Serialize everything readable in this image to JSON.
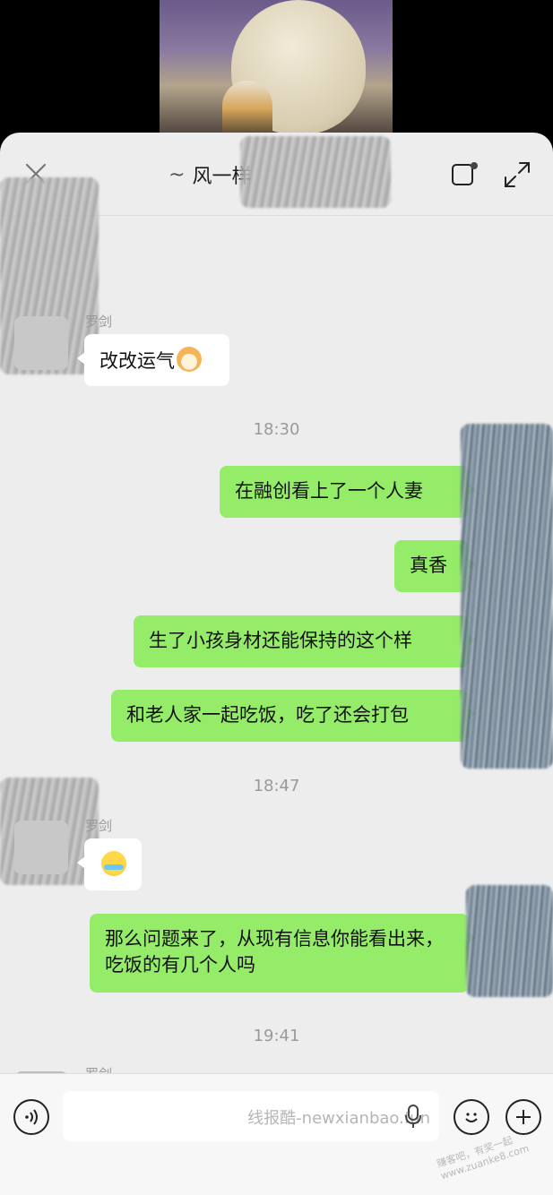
{
  "header": {
    "title_prefix": "~",
    "title": "风一样",
    "close_label": "close",
    "float_label": "float",
    "expand_label": "expand"
  },
  "messages": [
    {
      "type": "received",
      "sender": "罗剑",
      "text": "改改运气",
      "emoji": "doge"
    },
    {
      "type": "time",
      "text": "18:30"
    },
    {
      "type": "sent",
      "text": "在融创看上了一个人妻"
    },
    {
      "type": "sent",
      "text": "真香"
    },
    {
      "type": "sent",
      "text": "生了小孩身材还能保持的这个样"
    },
    {
      "type": "sent",
      "text": "和老人家一起吃饭，吃了还会打包"
    },
    {
      "type": "time",
      "text": "18:47"
    },
    {
      "type": "received",
      "sender": "罗剑",
      "text": "",
      "emoji": "cry"
    },
    {
      "type": "sent",
      "text": "那么问题来了，从现有信息你能看出来，吃饭的有几个人吗"
    },
    {
      "type": "time",
      "text": "19:41"
    },
    {
      "type": "received",
      "sender": "罗剑",
      "text": ""
    }
  ],
  "input": {
    "placeholder": "",
    "watermark": "线报酷-newxianbao.fun",
    "stamp_line1": "赚客吧，有奖一起",
    "stamp_line2": "www.zuanke8.com"
  },
  "colors": {
    "sent_bubble": "#95ec69",
    "received_bubble": "#ffffff",
    "chat_bg": "#ededed"
  },
  "icons": {
    "close": "close-icon",
    "float": "float-window-icon",
    "expand": "expand-icon",
    "voice": "voice-icon",
    "emoji": "emoji-icon",
    "plus": "plus-icon",
    "mic": "mic-icon"
  }
}
